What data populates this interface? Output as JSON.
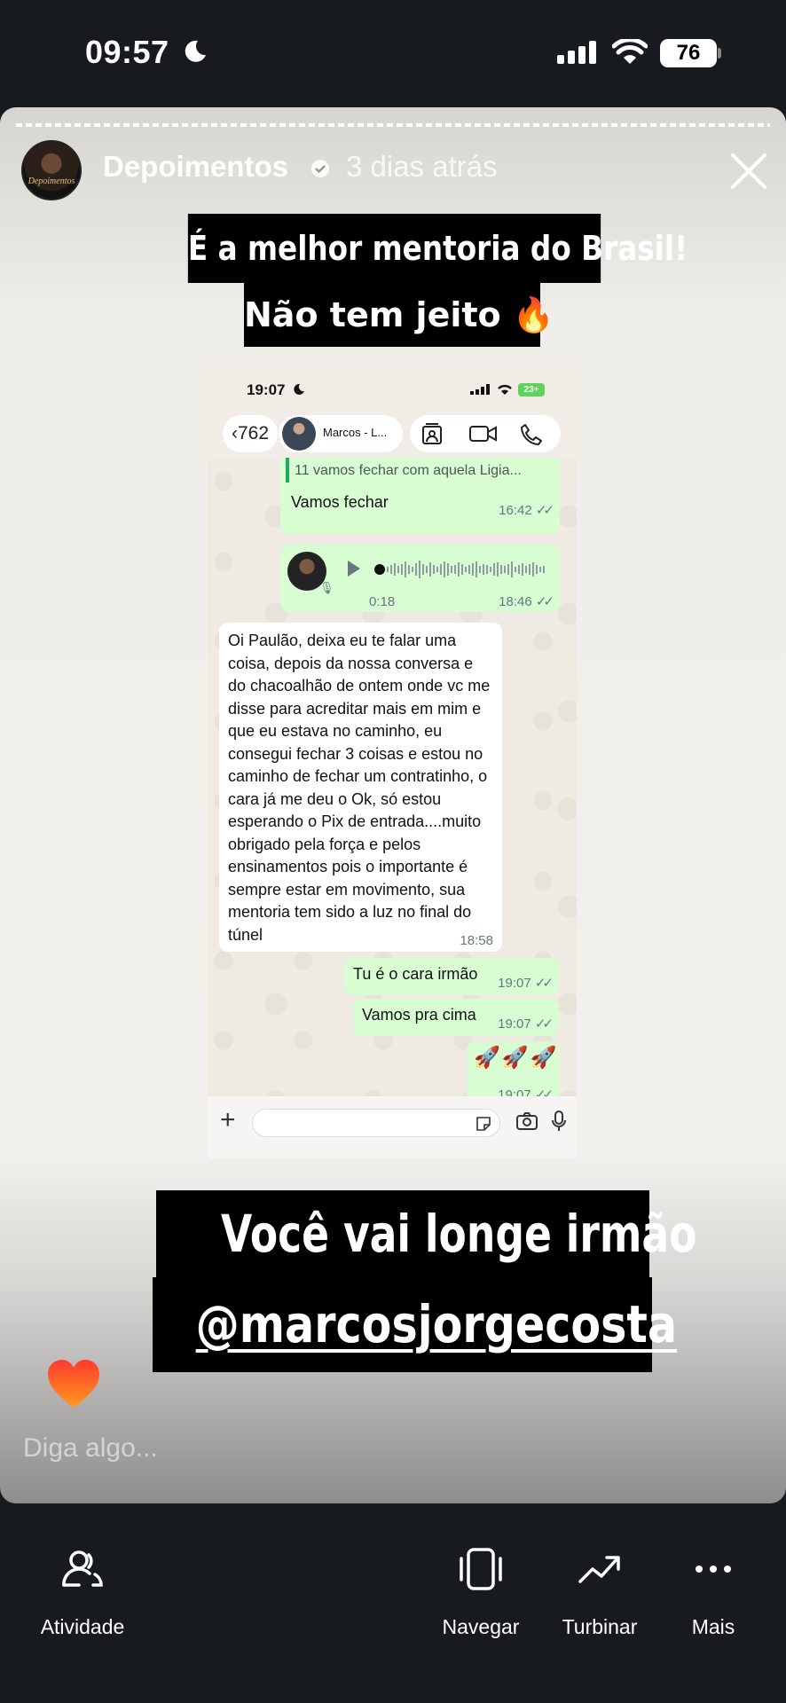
{
  "status_bar": {
    "time": "09:57",
    "battery": "76"
  },
  "story": {
    "author": "Depoimentos",
    "time_ago": "3 dias atrás",
    "avatar_text": "Depoimentos",
    "headline_1": "É a melhor mentoria do Brasil!",
    "headline_2": "Não tem jeito 🔥",
    "caption_1": "Você vai longe irmão",
    "caption_2": "@marcosjorgecosta",
    "reply_placeholder": "Diga algo..."
  },
  "embedded_chat": {
    "status_time": "19:07",
    "battery": "23+",
    "back_count": "762",
    "contact_name": "Marcos - L...",
    "quote_text": "11 vamos fechar com aquela Ligia...",
    "messages": [
      {
        "text": "Vamos fechar",
        "time": "16:42"
      },
      {
        "duration": "0:18",
        "time": "18:46"
      },
      {
        "text": "Oi Paulão, deixa eu te falar uma coisa, depois da nossa conversa e do chacoalhão de ontem onde vc me disse para acreditar mais em mim e que eu estava no caminho, eu consegui fechar 3 coisas e estou no caminho de fechar um contratinho, o cara já me deu o Ok, só estou esperando o Pix de entrada....muito obrigado pela força e pelos ensinamentos pois o importante é sempre estar em movimento, sua mentoria tem sido a luz no final do túnel",
        "time": "18:58"
      },
      {
        "text": "Tu é o cara irmão",
        "time": "19:07"
      },
      {
        "text": "Vamos pra cima",
        "time": "19:07"
      },
      {
        "text": "🚀🚀🚀",
        "time": "19:07"
      }
    ]
  },
  "bottom_nav": [
    {
      "label": "Atividade",
      "icon": "activity-icon"
    },
    {
      "label": "Navegar",
      "icon": "browse-icon"
    },
    {
      "label": "Turbinar",
      "icon": "boost-icon"
    },
    {
      "label": "Mais",
      "icon": "more-icon"
    }
  ],
  "colors": {
    "outgoing_bubble": "#d9fdd3",
    "incoming_bubble": "#ffffff",
    "chat_bg": "#efeae2",
    "app_bg": "#171a1f"
  }
}
